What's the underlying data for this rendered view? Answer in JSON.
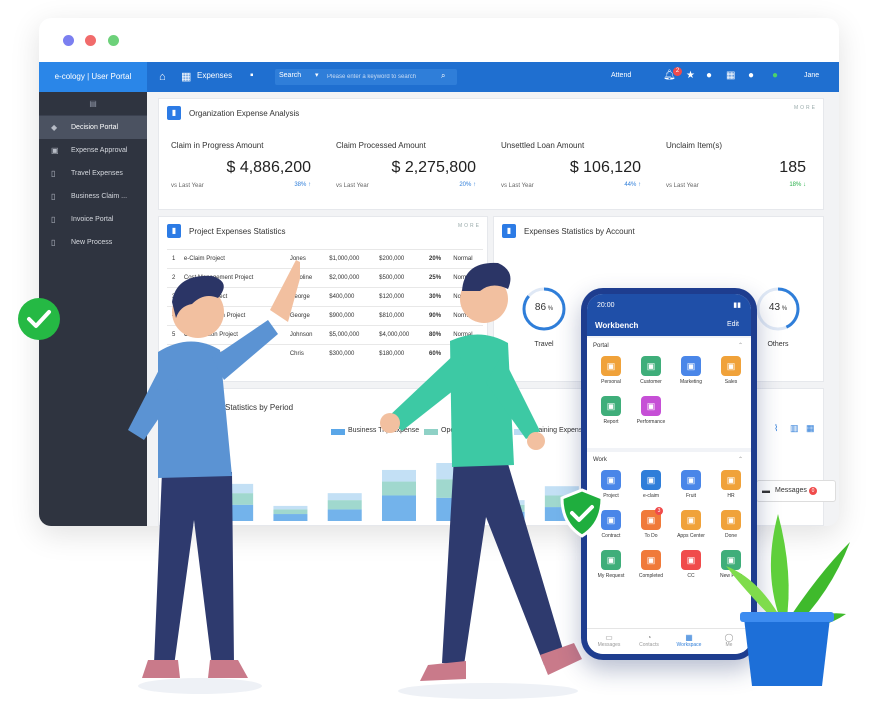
{
  "app": {
    "brand": "e-cology | User Portal",
    "module": "Expenses",
    "search_label": "Search",
    "search_placeholder": "Please enter a keyword to search",
    "attend_label": "Attend",
    "notification_count": "2",
    "user": "Jane"
  },
  "sidebar": {
    "items": [
      {
        "label": "Decision Portal",
        "icon": "cube-icon"
      },
      {
        "label": "Expense Approval",
        "icon": "chart-icon"
      },
      {
        "label": "Travel Expenses",
        "icon": "document-icon"
      },
      {
        "label": "Business Claim ...",
        "icon": "document-icon"
      },
      {
        "label": "Invoice Portal",
        "icon": "document-icon"
      },
      {
        "label": "New Process",
        "icon": "document-icon"
      }
    ]
  },
  "org_panel": {
    "title": "Organization Expense Analysis",
    "tools": "MORE",
    "stats": [
      {
        "label": "Claim in Progress Amount",
        "value": "$ 4,886,200",
        "note": "vs Last Year",
        "pct": "38%",
        "trend": "up"
      },
      {
        "label": "Claim Processed Amount",
        "value": "$ 2,275,800",
        "note": "vs Last Year",
        "pct": "20%",
        "trend": "up"
      },
      {
        "label": "Unsettled Loan Amount",
        "value": "$ 106,120",
        "note": "vs Last Year",
        "pct": "44%",
        "trend": "up"
      },
      {
        "label": "Unclaim Item(s)",
        "value": "185",
        "note": "vs Last Year",
        "pct": "18%",
        "trend": "down"
      }
    ]
  },
  "project_panel": {
    "title": "Project Expenses Statistics",
    "tools": "MORE",
    "rows": [
      {
        "no": "1",
        "name": "e-Claim Project",
        "owner": "Jones",
        "budget": "$1,000,000",
        "spent": "$200,000",
        "pct": "20%",
        "status": "Normal"
      },
      {
        "no": "2",
        "name": "Cost Management Project",
        "owner": "Caroline",
        "budget": "$2,000,000",
        "spent": "$500,000",
        "pct": "25%",
        "status": "Normal"
      },
      {
        "no": "3",
        "name": "Upgrade Project",
        "owner": "George",
        "budget": "$400,000",
        "spent": "$120,000",
        "pct": "30%",
        "status": "Normal"
      },
      {
        "no": "4",
        "name": "Implementation Project",
        "owner": "George",
        "budget": "$900,000",
        "spent": "$810,000",
        "pct": "90%",
        "status": "Normal"
      },
      {
        "no": "5",
        "name": "Construction Project",
        "owner": "Johnson",
        "budget": "$5,000,000",
        "spent": "$4,000,000",
        "pct": "80%",
        "status": "Normal"
      },
      {
        "no": "6",
        "name": "Consulting Project",
        "owner": "Chris",
        "budget": "$300,000",
        "spent": "$180,000",
        "pct": "60%",
        "status": "Normal"
      }
    ]
  },
  "account_panel": {
    "title": "Expenses Statistics by Account",
    "tools": "MORE",
    "gauges": [
      {
        "label": "Travel",
        "value": 86,
        "display": "86"
      },
      {
        "label": "Others",
        "value": 43,
        "display": "43"
      }
    ]
  },
  "period_panel": {
    "title": "Statistics by Period",
    "legend": [
      "Business Trip Expense",
      "Operations",
      "Training Expense"
    ],
    "colors": {
      "series1": "#5aa6e8",
      "series2": "#8fd1c6",
      "series3": "#b9dbf3"
    }
  },
  "chart_data": {
    "type": "bar",
    "title": "Statistics by Period",
    "series": [
      {
        "name": "Business Trip Expense",
        "values": [
          14,
          6,
          10,
          22,
          20,
          8,
          12
        ]
      },
      {
        "name": "Operations",
        "values": [
          10,
          4,
          8,
          12,
          16,
          6,
          10
        ]
      },
      {
        "name": "Training Expense",
        "values": [
          8,
          3,
          6,
          10,
          14,
          4,
          8
        ]
      }
    ]
  },
  "phone": {
    "time": "20:00",
    "title": "Workbench",
    "edit": "Edit",
    "portal_title": "Portal",
    "portal_apps": [
      {
        "label": "Personal",
        "color": "#f0a23a",
        "icon": "person-icon"
      },
      {
        "label": "Customer",
        "color": "#3fae7a",
        "icon": "customer-icon"
      },
      {
        "label": "Marketing",
        "color": "#4a86e8",
        "icon": "marketing-icon"
      },
      {
        "label": "Sales",
        "color": "#f0a23a",
        "icon": "sales-icon"
      },
      {
        "label": "Report",
        "color": "#3fae7a",
        "icon": "report-icon"
      },
      {
        "label": "Performance",
        "color": "#c64fd6",
        "icon": "performance-icon"
      }
    ],
    "work_title": "Work",
    "work_apps": [
      {
        "label": "Project",
        "color": "#4a86e8",
        "icon": "project-icon",
        "badge": ""
      },
      {
        "label": "e-claim",
        "color": "#2f7ed9",
        "icon": "eclaim-icon",
        "badge": ""
      },
      {
        "label": "Fruit",
        "color": "#4a86e8",
        "icon": "fruit-icon",
        "badge": ""
      },
      {
        "label": "HR",
        "color": "#f0a23a",
        "icon": "hr-icon",
        "badge": ""
      },
      {
        "label": "Contract",
        "color": "#4a86e8",
        "icon": "contract-icon",
        "badge": ""
      },
      {
        "label": "To Do",
        "color": "#f07a3a",
        "icon": "todo-icon",
        "badge": "3"
      },
      {
        "label": "Apps Center",
        "color": "#f0a23a",
        "icon": "apps-icon",
        "badge": ""
      },
      {
        "label": "Done",
        "color": "#f0a23a",
        "icon": "done-icon",
        "badge": ""
      },
      {
        "label": "My Request",
        "color": "#3fae7a",
        "icon": "request-icon",
        "badge": ""
      },
      {
        "label": "Completed",
        "color": "#f07a3a",
        "icon": "completed-icon",
        "badge": ""
      },
      {
        "label": "CC",
        "color": "#f04b4b",
        "icon": "cc-icon",
        "badge": ""
      },
      {
        "label": "New Flow",
        "color": "#3fae7a",
        "icon": "newflow-icon",
        "badge": ""
      }
    ],
    "nav": [
      "Messages",
      "Contacts",
      "Workspace",
      "Me"
    ]
  },
  "messages_pill": {
    "label": "Messages",
    "count": "0"
  }
}
